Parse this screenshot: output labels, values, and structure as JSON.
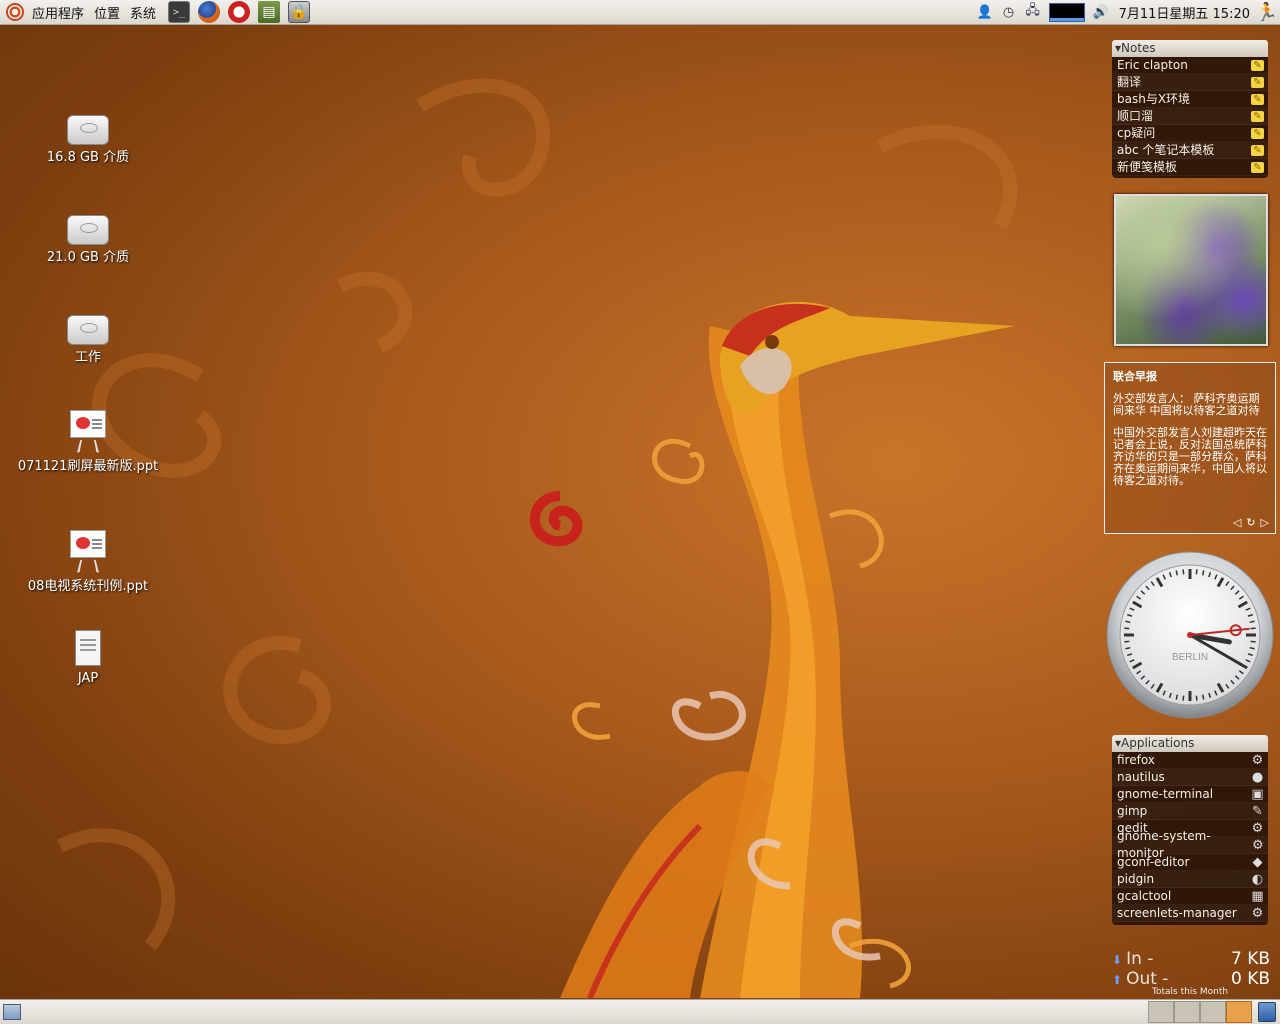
{
  "top_panel": {
    "menu": {
      "applications": "应用程序",
      "places": "位置",
      "system": "系统"
    },
    "launchers": [
      "terminal-icon",
      "firefox-icon",
      "opera-icon",
      "book-icon",
      "lock-icon"
    ],
    "tray": {
      "datetime": "7月11日星期五  15:20"
    }
  },
  "desktop_icons": [
    {
      "label": "16.8 GB 介质",
      "icon": "drive-icon"
    },
    {
      "label": "21.0 GB 介质",
      "icon": "drive-icon"
    },
    {
      "label": "工作",
      "icon": "drive-icon"
    },
    {
      "label": "071121刷屏最新版.ppt",
      "icon": "presentation-icon"
    },
    {
      "label": "08电视系统刊例.ppt",
      "icon": "presentation-icon"
    },
    {
      "label": "JAP",
      "icon": "document-icon"
    }
  ],
  "notes_widget": {
    "title": "▾Notes",
    "items": [
      "Eric clapton",
      "翻译",
      "bash与X环境",
      "顺口溜",
      "cp疑问",
      "abc 个笔记本模板",
      "新便笺模板"
    ]
  },
  "news_widget": {
    "source": "联合早报",
    "headline": "外交部发言人： 萨科齐奥运期间来华  中国将以待客之道对待",
    "body": "中国外交部发言人刘建超昨天在记者会上说，反对法国总统萨科齐访华的只是一部分群众，萨科齐在奥运期间来华，中国人将以待客之道对待。"
  },
  "clock_widget": {
    "city": "BERLIN",
    "hour": 3,
    "minute": 20,
    "second": 14
  },
  "applications_widget": {
    "title": "▾Applications",
    "items": [
      {
        "name": "firefox",
        "icon": "gear-icon"
      },
      {
        "name": "nautilus",
        "icon": "nautilus-icon"
      },
      {
        "name": "gnome-terminal",
        "icon": "terminal-icon"
      },
      {
        "name": "gimp",
        "icon": "gimp-icon"
      },
      {
        "name": "gedit",
        "icon": "gear-icon"
      },
      {
        "name": "gnome-system-monitor",
        "icon": "gear-icon"
      },
      {
        "name": "gconf-editor",
        "icon": "gconf-icon"
      },
      {
        "name": "pidgin",
        "icon": "pidgin-icon"
      },
      {
        "name": "gcalctool",
        "icon": "calculator-icon"
      },
      {
        "name": "screenlets-manager",
        "icon": "gear-icon"
      }
    ]
  },
  "network_widget": {
    "in_label": "In -",
    "in_value": "7 KB",
    "out_label": "Out -",
    "out_value": "0 KB",
    "caption": "Totals this Month"
  },
  "bottom_panel": {
    "workspaces": 4,
    "active_workspace": 4
  },
  "colors": {
    "panel": "#dcd8d0",
    "accent_orange": "#e9a04a",
    "wallpaper": "#a85a1c"
  }
}
